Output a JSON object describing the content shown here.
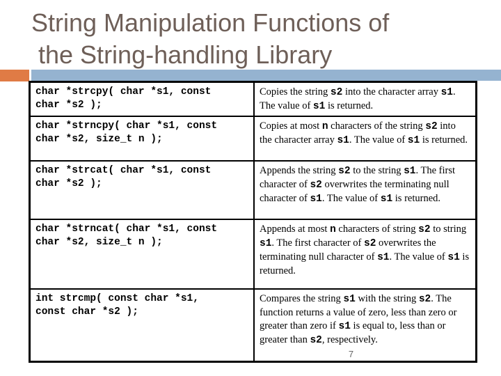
{
  "slide": {
    "title_line1": "String Manipulation Functions of",
    "title_line2": " the String-handling Library",
    "page_number": "7",
    "colors": {
      "title": "#6e5f58",
      "accent_orange": "#e07b45",
      "accent_blue": "#95b3d0"
    }
  },
  "functions": [
    {
      "prototype_lines": [
        "char *strcpy( char *s1, const",
        "char *s2 );"
      ],
      "description": [
        {
          "t": "Copies the string "
        },
        {
          "c": "s2"
        },
        {
          "t": " into the character array "
        },
        {
          "c": "s1"
        },
        {
          "t": ". The value of "
        },
        {
          "c": "s1"
        },
        {
          "t": " is returned."
        }
      ]
    },
    {
      "prototype_lines": [
        "char *strncpy( char *s1, const",
        "char *s2, size_t n );"
      ],
      "description": [
        {
          "t": "Copies at most "
        },
        {
          "c": "n"
        },
        {
          "t": " characters of the string "
        },
        {
          "c": "s2"
        },
        {
          "t": " into the character array "
        },
        {
          "c": "s1"
        },
        {
          "t": ". The value of "
        },
        {
          "c": "s1"
        },
        {
          "t": " is returned."
        }
      ]
    },
    {
      "prototype_lines": [
        "char *strcat( char *s1, const",
        "char *s2 );"
      ],
      "description": [
        {
          "t": "Appends the string "
        },
        {
          "c": "s2"
        },
        {
          "t": " to the string "
        },
        {
          "c": "s1"
        },
        {
          "t": ". The first character of "
        },
        {
          "c": "s2"
        },
        {
          "t": " overwrites the terminating null character of "
        },
        {
          "c": "s1"
        },
        {
          "t": ". The value of "
        },
        {
          "c": "s1"
        },
        {
          "t": " is returned."
        }
      ]
    },
    {
      "prototype_lines": [
        "char *strncat( char *s1, const",
        "char *s2, size_t n );"
      ],
      "description": [
        {
          "t": "Appends at most "
        },
        {
          "c": "n"
        },
        {
          "t": " characters of string "
        },
        {
          "c": "s2"
        },
        {
          "t": " to string "
        },
        {
          "c": "s1"
        },
        {
          "t": ". The first character of "
        },
        {
          "c": "s2"
        },
        {
          "t": " overwrites the terminating null character of "
        },
        {
          "c": "s1"
        },
        {
          "t": ". The value of "
        },
        {
          "c": "s1"
        },
        {
          "t": " is returned."
        }
      ]
    },
    {
      "prototype_lines": [
        "int strcmp( const char *s1,",
        "const char *s2 );"
      ],
      "description": [
        {
          "t": "Compares the string "
        },
        {
          "c": "s1"
        },
        {
          "t": " with the string "
        },
        {
          "c": "s2"
        },
        {
          "t": ". The function returns a value of zero, less than zero or greater than zero if "
        },
        {
          "c": "s1"
        },
        {
          "t": " is equal to, less than or greater than "
        },
        {
          "c": "s2"
        },
        {
          "t": ", respectively."
        }
      ]
    }
  ]
}
